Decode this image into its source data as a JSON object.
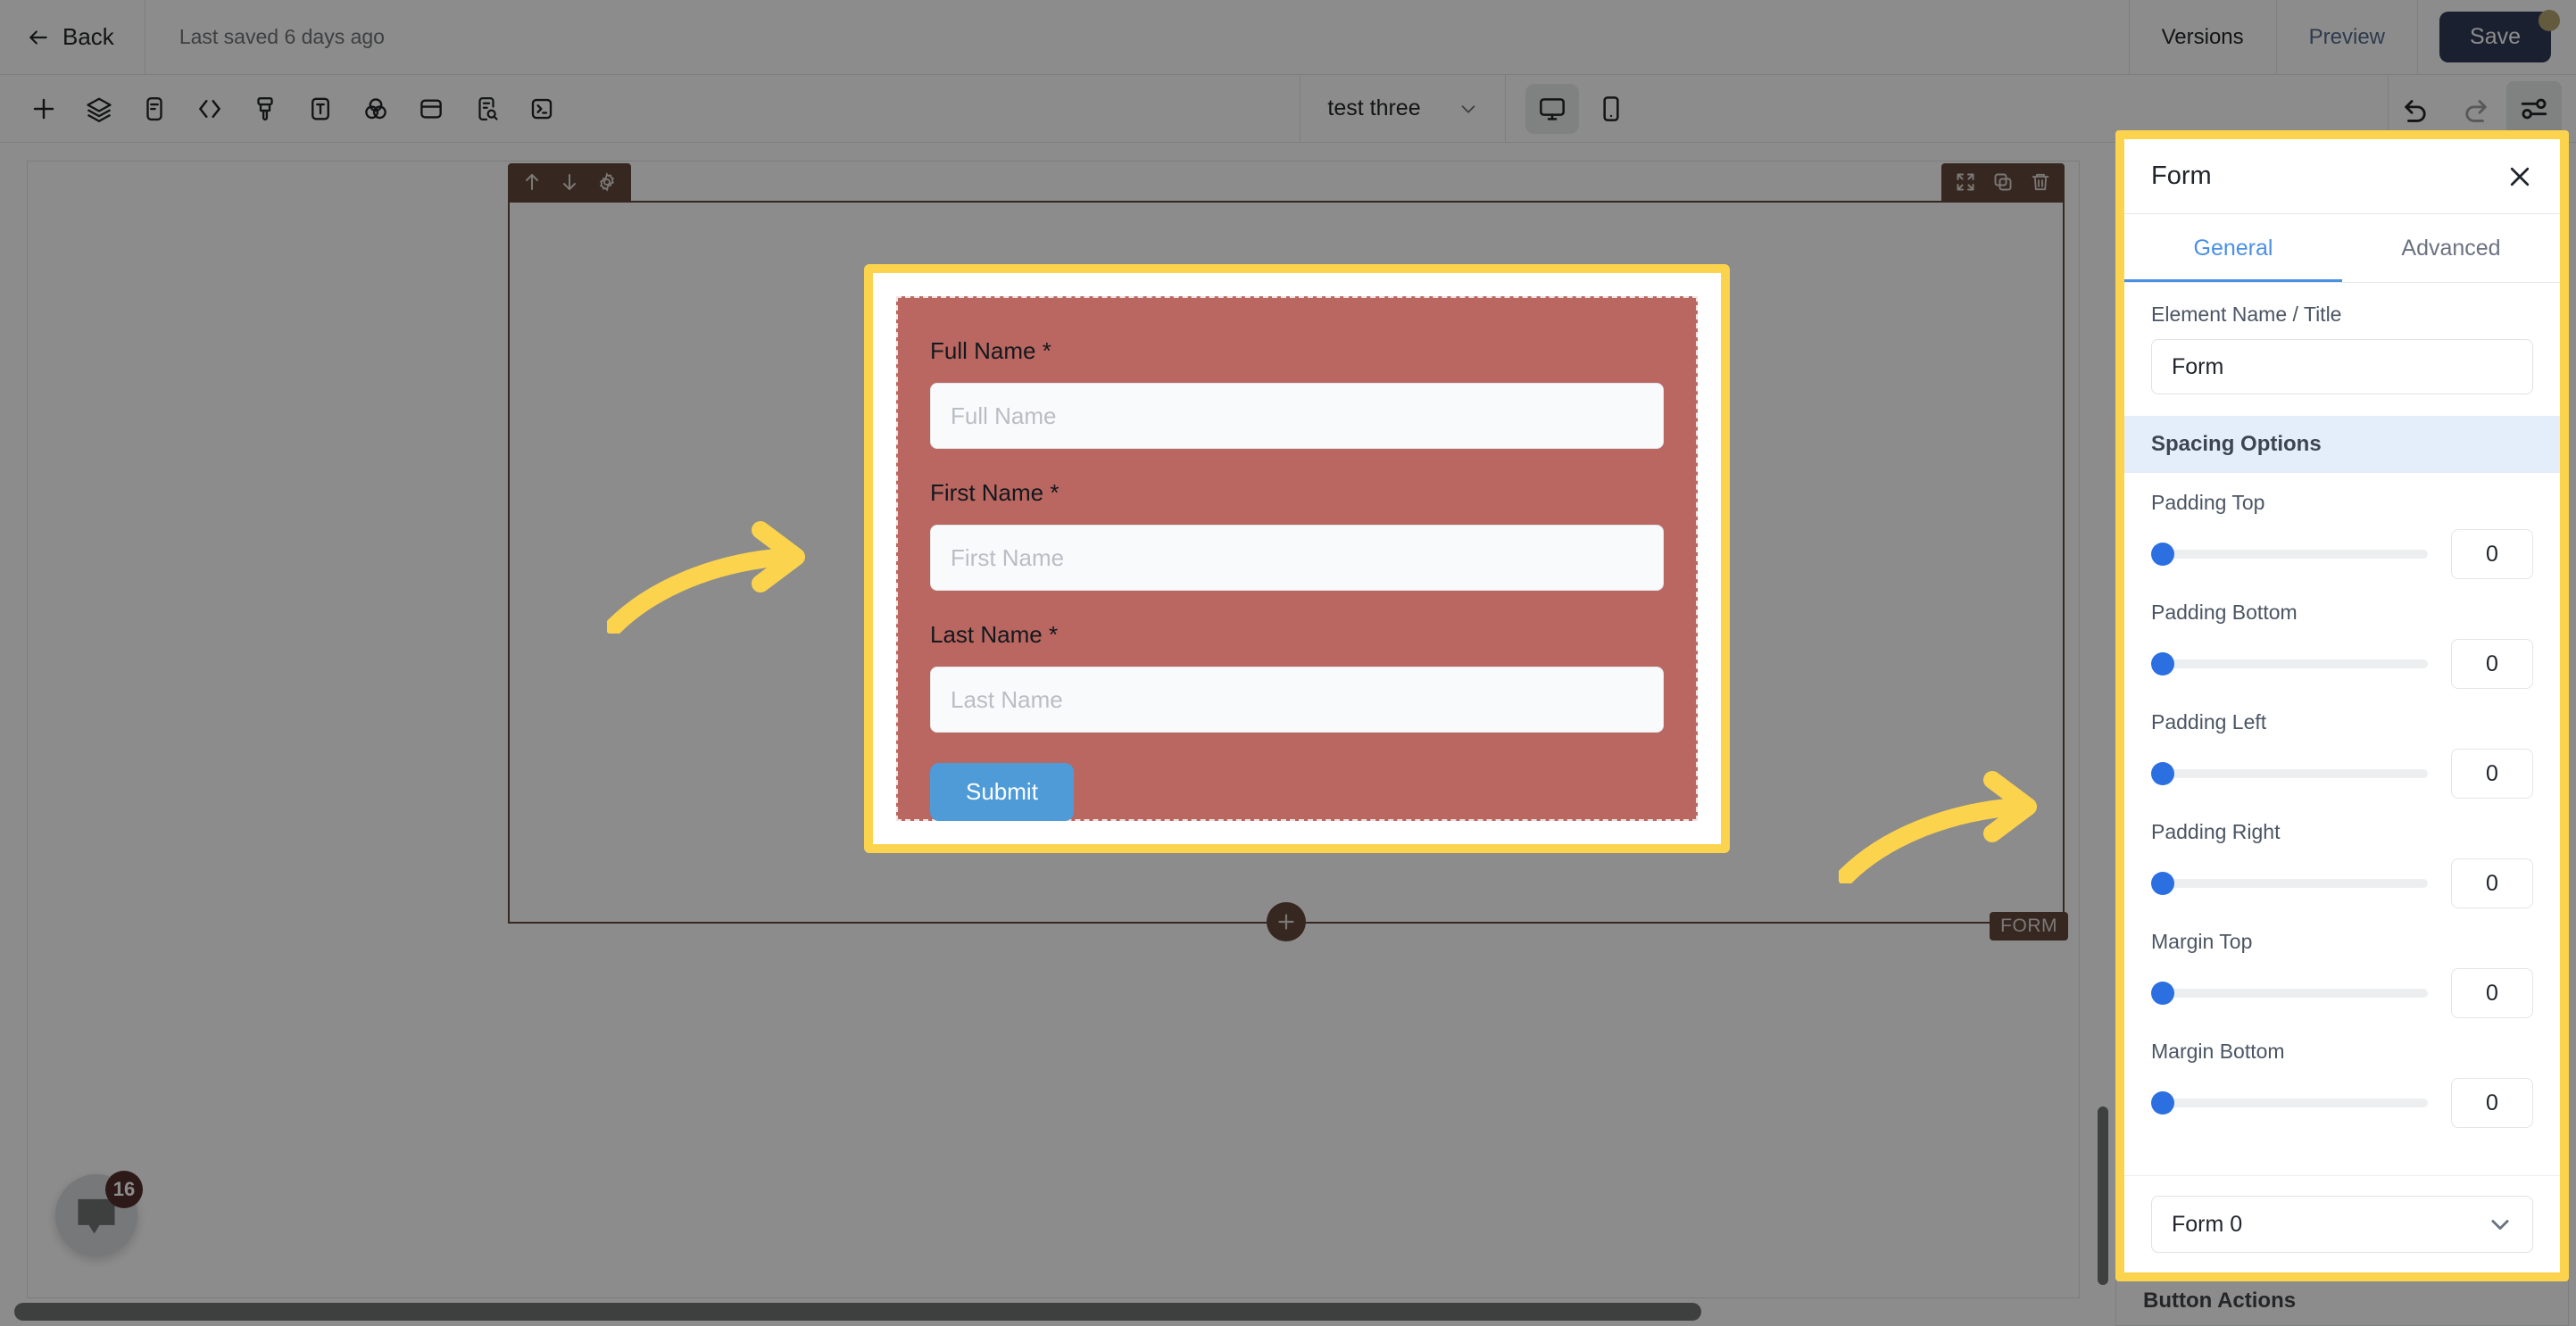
{
  "header": {
    "back_label": "Back",
    "saved_text": "Last saved 6 days ago",
    "versions_label": "Versions",
    "preview_label": "Preview",
    "save_label": "Save"
  },
  "toolbar": {
    "icons": [
      {
        "name": "add-icon",
        "label": "Add"
      },
      {
        "name": "layers-icon",
        "label": "Layers"
      },
      {
        "name": "document-icon",
        "label": "Document"
      },
      {
        "name": "code-icon",
        "label": "Code"
      },
      {
        "name": "brush-icon",
        "label": "Brush"
      },
      {
        "name": "text-icon",
        "label": "Text"
      },
      {
        "name": "color-blend-icon",
        "label": "Colors"
      },
      {
        "name": "container-icon",
        "label": "Container"
      },
      {
        "name": "document-search-icon",
        "label": "Inspect"
      },
      {
        "name": "terminal-icon",
        "label": "Terminal"
      }
    ],
    "page_selector": "test three",
    "desktop_view": "desktop-icon",
    "mobile_view": "mobile-icon",
    "undo": "undo-icon",
    "redo": "redo-icon",
    "settings": "settings-sliders-icon"
  },
  "canvas": {
    "section_tag": "FORM",
    "section_tools_left": [
      "move-up-icon",
      "move-down-icon",
      "gear-icon"
    ],
    "section_tools_right": [
      "expand-icon",
      "duplicate-icon",
      "delete-icon"
    ],
    "add_section": "plus-icon",
    "form": {
      "fields": [
        {
          "label": "Full Name *",
          "placeholder": "Full Name"
        },
        {
          "label": "First Name *",
          "placeholder": "First Name"
        },
        {
          "label": "Last Name *",
          "placeholder": "Last Name"
        }
      ],
      "submit_label": "Submit",
      "background_color": "#b96760",
      "submit_color": "#4e9bd8"
    }
  },
  "chat": {
    "badge_count": "16",
    "icon": "chat-bubble-icon"
  },
  "right_panel": {
    "title": "Form",
    "close_icon": "close-icon",
    "tabs": [
      {
        "label": "General",
        "active": true
      },
      {
        "label": "Advanced",
        "active": false
      }
    ],
    "element_name_label": "Element Name / Title",
    "element_name_value": "Form",
    "spacing_section_title": "Spacing Options",
    "sliders": [
      {
        "label": "Padding Top",
        "value": "0"
      },
      {
        "label": "Padding Bottom",
        "value": "0"
      },
      {
        "label": "Padding Left",
        "value": "0"
      },
      {
        "label": "Padding Right",
        "value": "0"
      },
      {
        "label": "Margin Top",
        "value": "0"
      },
      {
        "label": "Margin Bottom",
        "value": "0"
      }
    ],
    "footer_select_value": "Form 0",
    "below_section_title": "Button Actions",
    "highlight_color": "#fcd34d",
    "accent_color": "#4a90e2"
  }
}
